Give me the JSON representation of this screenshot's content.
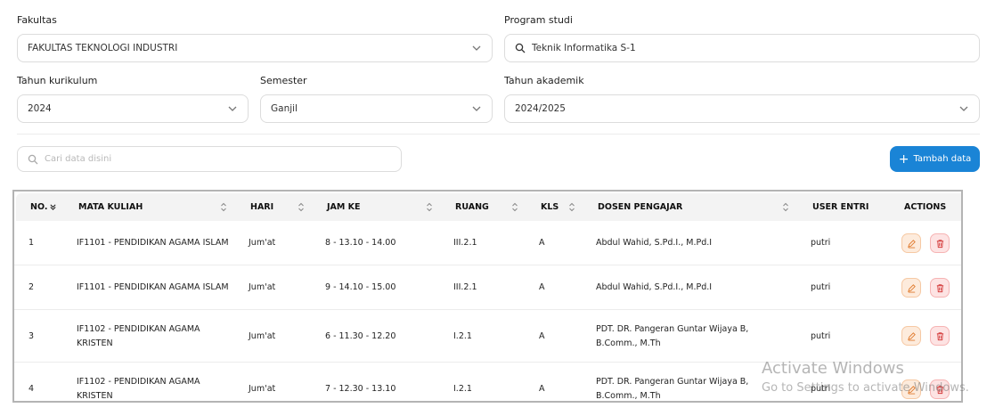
{
  "filters": {
    "fakultas": {
      "label": "Fakultas",
      "value": "FAKULTAS TEKNOLOGI INDUSTRI"
    },
    "program_studi": {
      "label": "Program studi",
      "value": "Teknik Informatika S-1"
    },
    "tahun_kurikulum": {
      "label": "Tahun kurikulum",
      "value": "2024"
    },
    "semester": {
      "label": "Semester",
      "value": "Ganjil"
    },
    "tahun_akademik": {
      "label": "Tahun akademik",
      "value": "2024/2025"
    }
  },
  "search": {
    "placeholder": "Cari data disini"
  },
  "add_button": {
    "label": "Tambah data"
  },
  "table": {
    "headers": {
      "no": "NO.",
      "mata_kuliah": "MATA KULIAH",
      "hari": "HARI",
      "jam_ke": "JAM KE",
      "ruang": "RUANG",
      "kls": "KLS",
      "dosen": "DOSEN PENGAJAR",
      "user_entri": "USER ENTRI",
      "actions": "ACTIONS"
    },
    "rows": [
      {
        "no": "1",
        "mata_kuliah": "IF1101 - PENDIDIKAN AGAMA ISLAM",
        "hari": "Jum'at",
        "jam_ke": "8 - 13.10 - 14.00",
        "ruang": "III.2.1",
        "kls": "A",
        "dosen": "Abdul Wahid, S.Pd.I., M.Pd.I",
        "user_entri": "putri"
      },
      {
        "no": "2",
        "mata_kuliah": "IF1101 - PENDIDIKAN AGAMA ISLAM",
        "hari": "Jum'at",
        "jam_ke": "9 - 14.10 - 15.00",
        "ruang": "III.2.1",
        "kls": "A",
        "dosen": "Abdul Wahid, S.Pd.I., M.Pd.I",
        "user_entri": "putri"
      },
      {
        "no": "3",
        "mata_kuliah": "IF1102 - PENDIDIKAN AGAMA KRISTEN",
        "hari": "Jum'at",
        "jam_ke": "6 - 11.30 - 12.20",
        "ruang": "I.2.1",
        "kls": "A",
        "dosen": "PDT. DR. Pangeran Guntar Wijaya B, B.Comm., M.Th",
        "user_entri": "putri"
      },
      {
        "no": "4",
        "mata_kuliah": "IF1102 - PENDIDIKAN AGAMA KRISTEN",
        "hari": "Jum'at",
        "jam_ke": "7 - 12.30 - 13.10",
        "ruang": "I.2.1",
        "kls": "A",
        "dosen": "PDT. DR. Pangeran Guntar Wijaya B, B.Comm., M.Th",
        "user_entri": "putri"
      }
    ]
  },
  "watermark": {
    "line1": "Activate Windows",
    "line2": "Go to Settings to activate Windows."
  },
  "colors": {
    "primary": "#1a84d6",
    "edit": "#e07b2f",
    "delete": "#d43c3c"
  }
}
